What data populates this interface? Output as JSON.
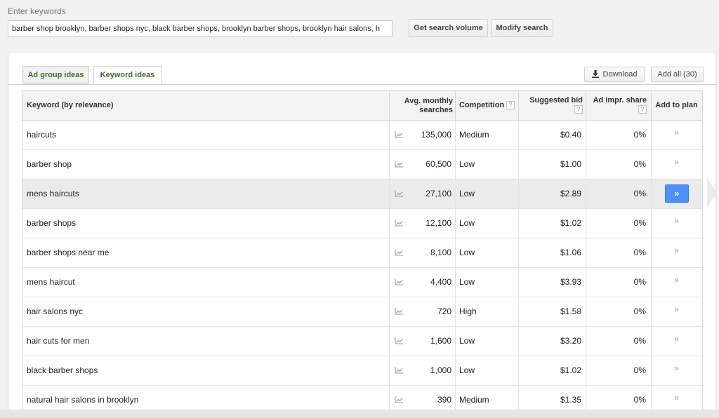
{
  "search": {
    "label": "Enter keywords",
    "value": "barber shop brooklyn, barber shops nyc, black barber shops, brooklyn barber shops, brooklyn hair salons, h",
    "get_volume_label": "Get search volume",
    "modify_label": "Modify search"
  },
  "tabs": [
    {
      "label": "Ad group ideas",
      "active": false
    },
    {
      "label": "Keyword ideas",
      "active": true
    }
  ],
  "toolbar": {
    "download_label": "Download",
    "add_all_label": "Add all (30)"
  },
  "table": {
    "headers": {
      "keyword": "Keyword (by relevance)",
      "searches_1": "Avg. monthly",
      "searches_2": "searches",
      "competition": "Competition",
      "bid": "Suggested bid",
      "impr": "Ad impr. share",
      "add": "Add to plan"
    },
    "help_glyph": "?",
    "add_glyph": "»",
    "rows": [
      {
        "keyword": "haircuts",
        "searches": "135,000",
        "competition": "Medium",
        "bid": "$0.40",
        "share": "0%",
        "highlighted": false
      },
      {
        "keyword": "barber shop",
        "searches": "60,500",
        "competition": "Low",
        "bid": "$1.00",
        "share": "0%",
        "highlighted": false
      },
      {
        "keyword": "mens haircuts",
        "searches": "27,100",
        "competition": "Low",
        "bid": "$2.89",
        "share": "0%",
        "highlighted": true
      },
      {
        "keyword": "barber shops",
        "searches": "12,100",
        "competition": "Low",
        "bid": "$1.02",
        "share": "0%",
        "highlighted": false
      },
      {
        "keyword": "barber shops near me",
        "searches": "8,100",
        "competition": "Low",
        "bid": "$1.06",
        "share": "0%",
        "highlighted": false
      },
      {
        "keyword": "mens haircut",
        "searches": "4,400",
        "competition": "Low",
        "bid": "$3.93",
        "share": "0%",
        "highlighted": false
      },
      {
        "keyword": "hair salons nyc",
        "searches": "720",
        "competition": "High",
        "bid": "$1.58",
        "share": "0%",
        "highlighted": false
      },
      {
        "keyword": "hair cuts for men",
        "searches": "1,600",
        "competition": "Low",
        "bid": "$3.20",
        "share": "0%",
        "highlighted": false
      },
      {
        "keyword": "black barber shops",
        "searches": "1,000",
        "competition": "Low",
        "bid": "$1.02",
        "share": "0%",
        "highlighted": false
      },
      {
        "keyword": "natural hair salons in brooklyn",
        "searches": "390",
        "competition": "Medium",
        "bid": "$1.35",
        "share": "0%",
        "highlighted": false
      }
    ]
  },
  "colors": {
    "accent": "#4d90fe",
    "tab_text": "#3b6e22",
    "highlight_row": "#ebebeb"
  }
}
